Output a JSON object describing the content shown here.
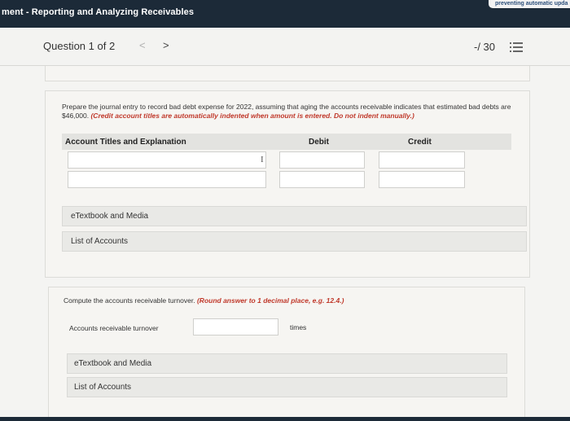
{
  "header": {
    "title": "ment - Reporting and Analyzing Receivables",
    "notice": "preventing automatic upda"
  },
  "question_bar": {
    "question_label": "Question 1 of 2",
    "prev_glyph": "<",
    "next_glyph": ">",
    "score": "-/ 30"
  },
  "part1": {
    "prompt": "Prepare the journal entry to record bad debt expense for 2022, assuming that aging the accounts receivable indicates that estimated bad debts are $46,000.",
    "instruction": "(Credit account titles are automatically indented when amount is entered. Do not indent manually.)",
    "table": {
      "headers": [
        "Account Titles and Explanation",
        "Debit",
        "Credit"
      ],
      "rows": [
        {
          "account": "",
          "debit": "",
          "credit": ""
        },
        {
          "account": "",
          "debit": "",
          "credit": ""
        }
      ]
    },
    "links": [
      "eTextbook and Media",
      "List of Accounts"
    ]
  },
  "part2": {
    "prompt": "Compute the accounts receivable turnover.",
    "instruction": "(Round answer to 1 decimal place, e.g. 12.4.)",
    "field_label": "Accounts receivable turnover",
    "field_value": "",
    "unit": "times",
    "links": [
      "eTextbook and Media",
      "List of Accounts"
    ]
  },
  "colors": {
    "header_bg": "#1c2a38",
    "instruction_red": "#c0392b",
    "panel_bg": "#f6f5f2"
  },
  "icons": {
    "question_list": "list-icon",
    "text_cursor": "i-beam-cursor-icon"
  }
}
